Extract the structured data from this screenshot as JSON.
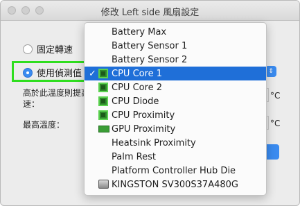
{
  "window": {
    "title": "修改 Left side 風扇設定"
  },
  "options": {
    "fixed_speed_label": "固定轉速",
    "sensor_label": "使用偵測值"
  },
  "labels": {
    "raise_line1": "高於此溫度則提高",
    "raise_line2": "速：",
    "max_temp": "最高溫度：",
    "unit1": "°C",
    "unit2": "°C"
  },
  "sensor_menu": {
    "selected": "CPU Core 1",
    "items": [
      {
        "label": "Battery Max",
        "icon": ""
      },
      {
        "label": "Battery Sensor 1",
        "icon": ""
      },
      {
        "label": "Battery Sensor 2",
        "icon": ""
      },
      {
        "label": "CPU Core 1",
        "icon": "cpu-chip-icon",
        "check": "✓"
      },
      {
        "label": "CPU Core 2",
        "icon": "cpu-chip-icon"
      },
      {
        "label": "CPU Diode",
        "icon": "cpu-chip-icon"
      },
      {
        "label": "CPU Proximity",
        "icon": "cpu-chip-icon"
      },
      {
        "label": "GPU Proximity",
        "icon": "gpu-card-icon"
      },
      {
        "label": "Heatsink Proximity",
        "icon": ""
      },
      {
        "label": "Palm Rest",
        "icon": ""
      },
      {
        "label": "Platform Controller Hub Die",
        "icon": ""
      },
      {
        "label": "KINGSTON SV300S37A480G",
        "icon": "disk-drive-icon"
      }
    ]
  },
  "colors": {
    "selection": "#1f6fd8",
    "annotation_box": "#2fde1f",
    "accent": "#3a8bf0"
  }
}
